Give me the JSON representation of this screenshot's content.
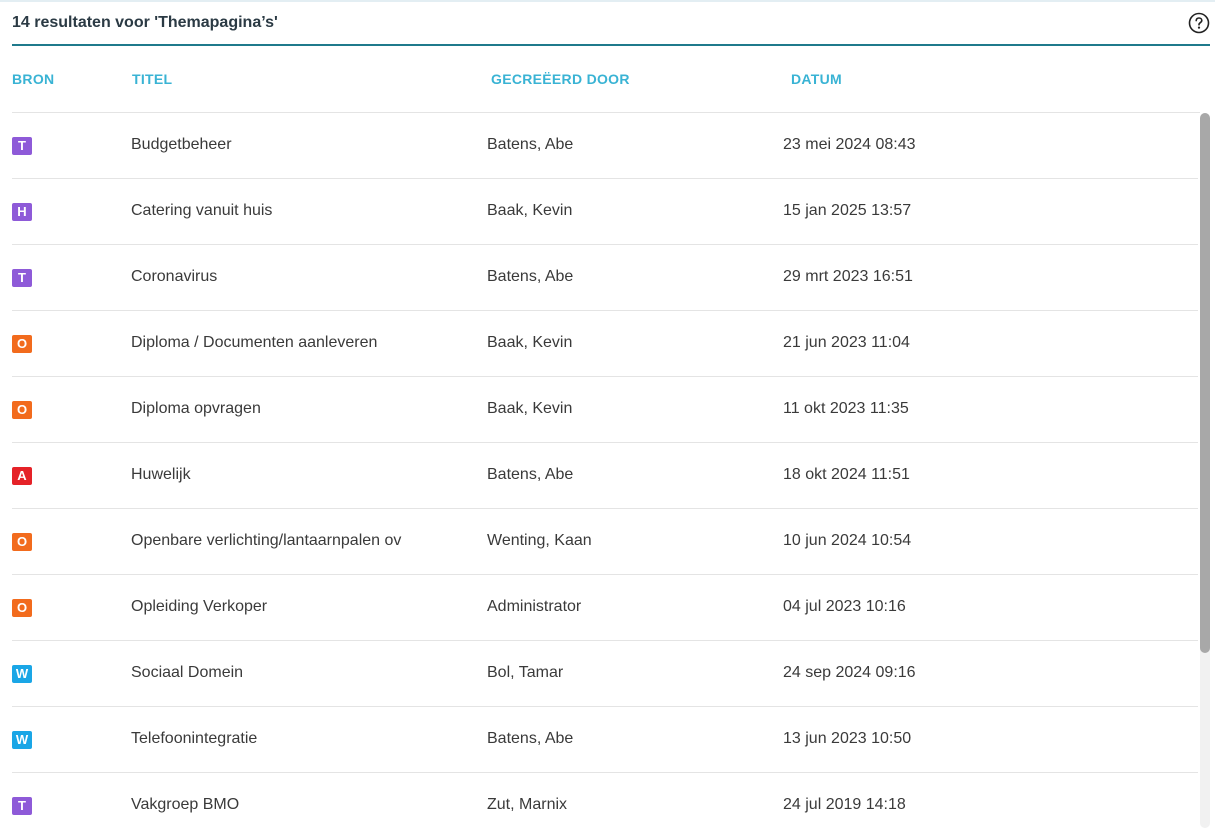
{
  "header": {
    "title": "14 resultaten voor 'Themapagina’s'",
    "help_icon": "help-circle-icon"
  },
  "columns": {
    "source": "BRON",
    "title": "TITEL",
    "created_by": "GECREËERD DOOR",
    "date": "DATUM"
  },
  "badge_colors": {
    "T": "#8e5ad8",
    "H": "#8e5ad8",
    "O": "#f26b1d",
    "A": "#e52228",
    "W": "#1aa6e6"
  },
  "rows": [
    {
      "source": "T",
      "title": "Budgetbeheer",
      "created_by": "Batens, Abe",
      "date": "23 mei 2024 08:43"
    },
    {
      "source": "H",
      "title": "Catering vanuit huis",
      "created_by": "Baak, Kevin",
      "date": "15 jan 2025 13:57"
    },
    {
      "source": "T",
      "title": "Coronavirus",
      "created_by": "Batens, Abe",
      "date": "29 mrt 2023 16:51"
    },
    {
      "source": "O",
      "title": "Diploma / Documenten aanleveren",
      "created_by": "Baak, Kevin",
      "date": "21 jun 2023 11:04"
    },
    {
      "source": "O",
      "title": "Diploma opvragen",
      "created_by": "Baak, Kevin",
      "date": "11 okt 2023 11:35"
    },
    {
      "source": "A",
      "title": "Huwelijk",
      "created_by": "Batens, Abe",
      "date": "18 okt 2024 11:51"
    },
    {
      "source": "O",
      "title": "Openbare verlichting/lantaarnpalen ov",
      "created_by": "Wenting, Kaan",
      "date": "10 jun 2024 10:54"
    },
    {
      "source": "O",
      "title": "Opleiding Verkoper",
      "created_by": "Administrator",
      "date": "04 jul 2023 10:16"
    },
    {
      "source": "W",
      "title": "Sociaal Domein",
      "created_by": "Bol, Tamar",
      "date": "24 sep 2024 09:16"
    },
    {
      "source": "W",
      "title": "Telefoonintegratie",
      "created_by": "Batens, Abe",
      "date": "13 jun 2023 10:50"
    },
    {
      "source": "T",
      "title": "Vakgroep BMO",
      "created_by": "Zut, Marnix",
      "date": "24 jul 2019 14:18"
    }
  ]
}
